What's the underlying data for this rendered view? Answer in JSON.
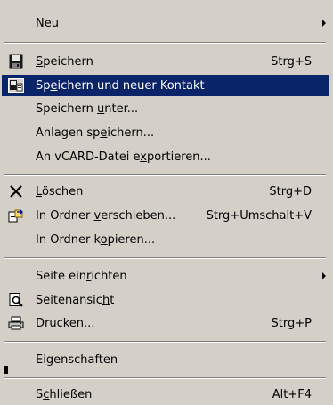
{
  "menu": {
    "items": [
      {
        "pre": "",
        "acc": "N",
        "post": "eu",
        "shortcut": "",
        "submenu": true,
        "icon": ""
      },
      {
        "pre": "",
        "acc": "S",
        "post": "peichern",
        "shortcut": "Strg+S",
        "icon": "save-icon"
      },
      {
        "pre": "Sp",
        "acc": "e",
        "post": "ichern und neuer Kontakt",
        "shortcut": "",
        "icon": "save-new-contact-icon",
        "highlighted": true
      },
      {
        "pre": "Speichern ",
        "acc": "u",
        "post": "nter...",
        "shortcut": ""
      },
      {
        "pre": "Anlagen sp",
        "acc": "e",
        "post": "ichern...",
        "shortcut": ""
      },
      {
        "pre": "An vCARD-Datei e",
        "acc": "x",
        "post": "portieren...",
        "shortcut": ""
      },
      {
        "pre": "",
        "acc": "L",
        "post": "öschen",
        "shortcut": "Strg+D",
        "icon": "delete-x-icon"
      },
      {
        "pre": "In Ordner ",
        "acc": "v",
        "post": "erschieben...",
        "shortcut": "Strg+Umschalt+V",
        "icon": "move-to-folder-icon"
      },
      {
        "pre": "In Ordner k",
        "acc": "o",
        "post": "pieren...",
        "shortcut": ""
      },
      {
        "pre": "Seite ein",
        "acc": "r",
        "post": "ichten",
        "shortcut": "",
        "submenu": true
      },
      {
        "pre": "Seitenansic",
        "acc": "h",
        "post": "t",
        "shortcut": "",
        "icon": "print-preview-icon"
      },
      {
        "pre": "",
        "acc": "D",
        "post": "rucken...",
        "shortcut": "Strg+P",
        "icon": "printer-icon"
      },
      {
        "pre": "Ei",
        "acc": "g",
        "post": "enschaften",
        "shortcut": ""
      },
      {
        "pre": "S",
        "acc": "c",
        "post": "hließen",
        "shortcut": "Alt+F4"
      }
    ]
  },
  "colors": {
    "menu_background": "#d4d0c8",
    "highlight_background": "#0a246a",
    "highlight_text": "#ffffff"
  }
}
